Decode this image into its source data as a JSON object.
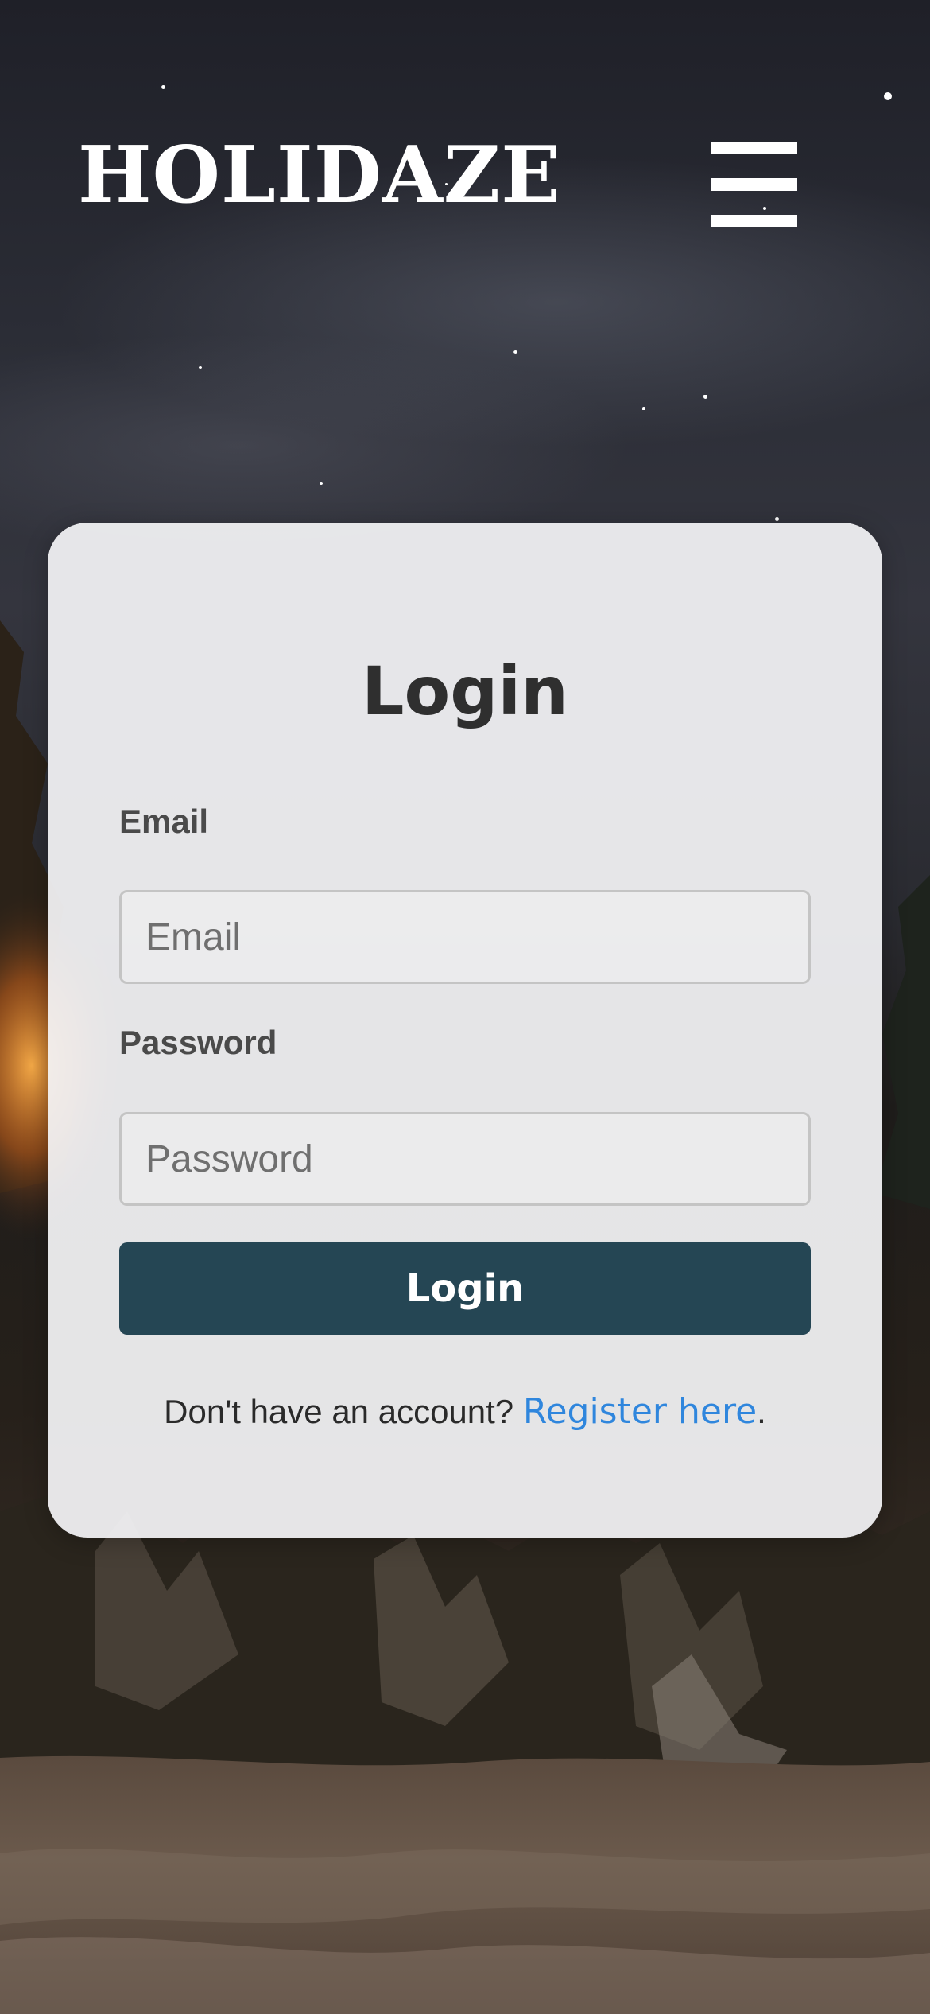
{
  "header": {
    "logo": "HOLIDAZE",
    "menu_icon": "hamburger-menu-icon"
  },
  "login_form": {
    "title": "Login",
    "email": {
      "label": "Email",
      "placeholder": "Email",
      "value": ""
    },
    "password": {
      "label": "Password",
      "placeholder": "Password",
      "value": ""
    },
    "submit_label": "Login",
    "register_prompt": "Don't have an account? ",
    "register_link": "Register here",
    "register_suffix": "."
  },
  "colors": {
    "button": "#254654",
    "link": "#2f86dd",
    "card": "#f4f4f6",
    "text": "#2f2f2f"
  }
}
